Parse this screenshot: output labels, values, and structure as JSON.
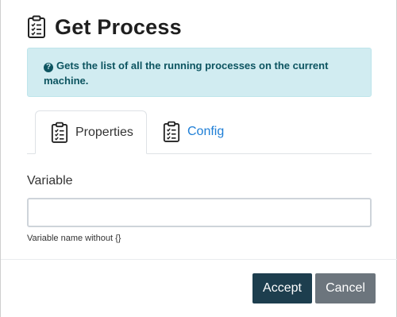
{
  "dialog": {
    "title": "Get Process",
    "title_icon": "clipboard-list-icon"
  },
  "info": {
    "icon": "question-circle-icon",
    "text": "Gets the list of all the running processes on the current machine."
  },
  "tabs": [
    {
      "label": "Properties",
      "icon": "clipboard-list-icon",
      "active": true
    },
    {
      "label": "Config",
      "icon": "clipboard-list-icon",
      "active": false
    }
  ],
  "form": {
    "variable_label": "Variable",
    "variable_value": "",
    "variable_help": "Variable name without {}"
  },
  "buttons": {
    "accept_label": "Accept",
    "cancel_label": "Cancel"
  },
  "colors": {
    "accept_bg": "#1d3e4e",
    "cancel_bg": "#6c757d",
    "info_bg": "#d1ecf1",
    "info_text": "#0c5460",
    "link": "#1e7ed6"
  }
}
